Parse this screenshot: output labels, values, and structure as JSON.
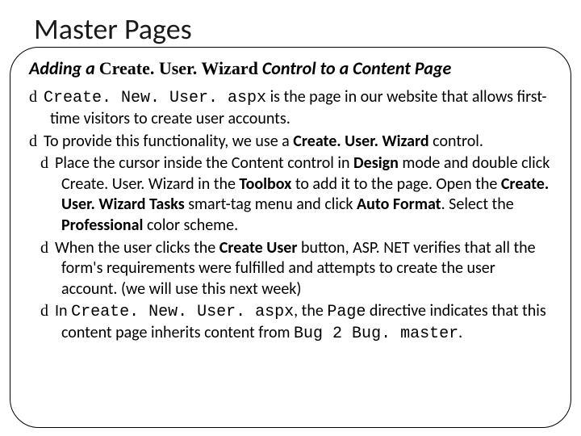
{
  "title": "Master Pages",
  "subtitle": {
    "prefix": "Adding a ",
    "code": "Create. User. Wizard",
    "suffix": " Control to a Content Page"
  },
  "bullets": {
    "b1": {
      "code1": "Create. New. User. aspx",
      "t1": " is the page in our website that allows first-time visitors to create user accounts."
    },
    "b2": {
      "t1": "To provide this functionality, we use a ",
      "bold1": "Create. User. Wizard",
      "t2": " control."
    },
    "b3": {
      "t1": "Place the cursor inside the Content control in ",
      "bold1": "Design",
      "t2": " mode and double click Create. User. Wizard in the ",
      "bold2": "Toolbox",
      "t3": " to add it to the page. Open the ",
      "bold3": "Create. User. Wizard Tasks",
      "t4": " smart-tag menu and click ",
      "bold4": "Auto Format",
      "t5": ". Select the ",
      "bold5": "Professional",
      "t6": " color scheme."
    },
    "b4": {
      "t1": "When the user clicks the ",
      "bold1": "Create User",
      "t2": " button, ASP. NET verifies that all the form's requirements were fulfilled and attempts to create the user account. (we will use this next week)"
    },
    "b5": {
      "t1": "In ",
      "code1": "Create. New. User. aspx",
      "t2": ", the ",
      "code2": "Page",
      "t3": " directive indicates that this content page inherits content from ",
      "code3": "Bug 2 Bug. master",
      "t4": "."
    }
  },
  "glyph": "d"
}
